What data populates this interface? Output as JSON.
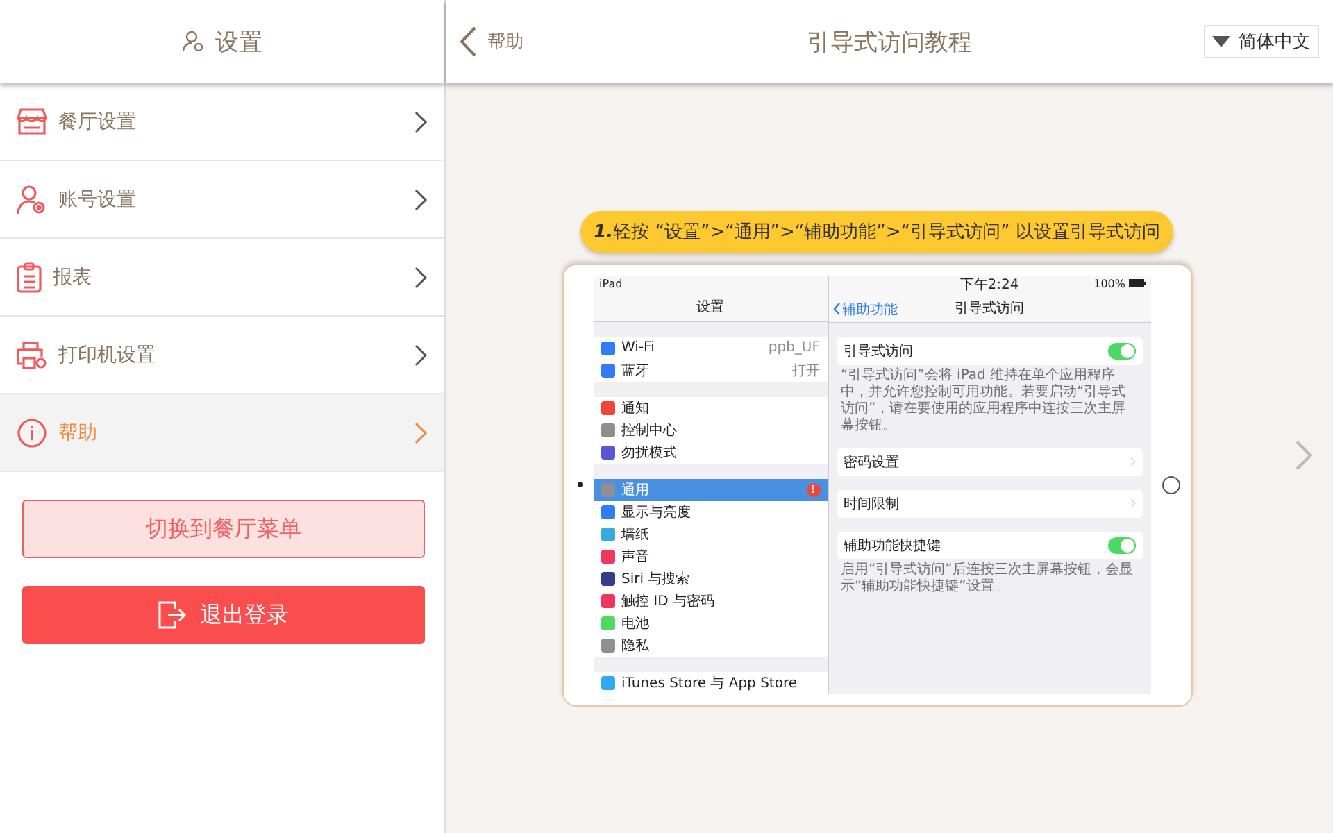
{
  "sidebar": {
    "title": "设置",
    "items": [
      {
        "label": "餐厅设置",
        "kind": "store",
        "selected": false
      },
      {
        "label": "账号设置",
        "kind": "account",
        "selected": false
      },
      {
        "label": "报表",
        "kind": "report",
        "selected": false
      },
      {
        "label": "打印机设置",
        "kind": "printer",
        "selected": false
      },
      {
        "label": "帮助",
        "kind": "info",
        "selected": true
      }
    ],
    "buttons": [
      {
        "label": "切换到餐厅菜单",
        "kind": "secondary"
      },
      {
        "label": "退出登录",
        "kind": "primary"
      }
    ]
  },
  "header": {
    "back": "帮助",
    "title": "引导式访问教程",
    "language": "简体中文"
  },
  "tutorial": {
    "instruction": "**1.**轻按 “设置”>“通用”>“辅助功能”>“引导式访问” 以设置引导式访问",
    "device": {
      "left": {
        "status": "iPad",
        "title": "设置",
        "groups": [
          {
            "rows": [
              {
                "label": "Wi-Fi",
                "value": "ppb_UF",
                "color": "#2f7cf6",
                "selected": false
              },
              {
                "label": "蓝牙",
                "value": "打开",
                "color": "#2f7cf6",
                "selected": false
              }
            ]
          },
          {
            "rows": [
              {
                "label": "通知",
                "color": "#f0453a",
                "selected": false
              },
              {
                "label": "控制中心",
                "color": "#8e8e93",
                "selected": false
              },
              {
                "label": "勿扰模式",
                "color": "#5856d6",
                "selected": false
              }
            ]
          },
          {
            "rows": [
              {
                "label": "通用",
                "color": "#8e8e93",
                "selected": true,
                "badge": "!"
              },
              {
                "label": "显示与亮度",
                "color": "#2f7cf6",
                "selected": false
              },
              {
                "label": "墙纸",
                "color": "#35aadc",
                "selected": false
              },
              {
                "label": "声音",
                "color": "#f0365a",
                "selected": false
              },
              {
                "label": "Siri 与搜索",
                "color": "#3a3a8c",
                "selected": false
              },
              {
                "label": "触控 ID 与密码",
                "color": "#f0365a",
                "selected": false
              },
              {
                "label": "电池",
                "color": "#4cd964",
                "selected": false
              },
              {
                "label": "隐私",
                "color": "#8e8e93",
                "selected": false
              }
            ]
          },
          {
            "rows": [
              {
                "label": "iTunes Store 与 App Store",
                "color": "#2fa8f6",
                "selected": false
              }
            ]
          }
        ]
      },
      "right": {
        "time": "下午2:24",
        "battery": "100%",
        "back": "辅助功能",
        "title": "引导式访问",
        "sections": [
          {
            "kind": "toggle",
            "label": "引导式访问",
            "on": true,
            "note": "“引导式访问”会将 iPad 维持在单个应用程序中，并允许您控制可用功能。若要启动“引导式访问”，请在要使用的应用程序中连按三次主屏幕按钮。"
          },
          {
            "kind": "link",
            "label": "密码设置"
          },
          {
            "kind": "link",
            "label": "时间限制"
          },
          {
            "kind": "toggle",
            "label": "辅助功能快捷键",
            "on": true,
            "note": "启用“引导式访问”后连按三次主屏幕按钮，会显示“辅助功能快捷键”设置。"
          }
        ]
      }
    }
  }
}
